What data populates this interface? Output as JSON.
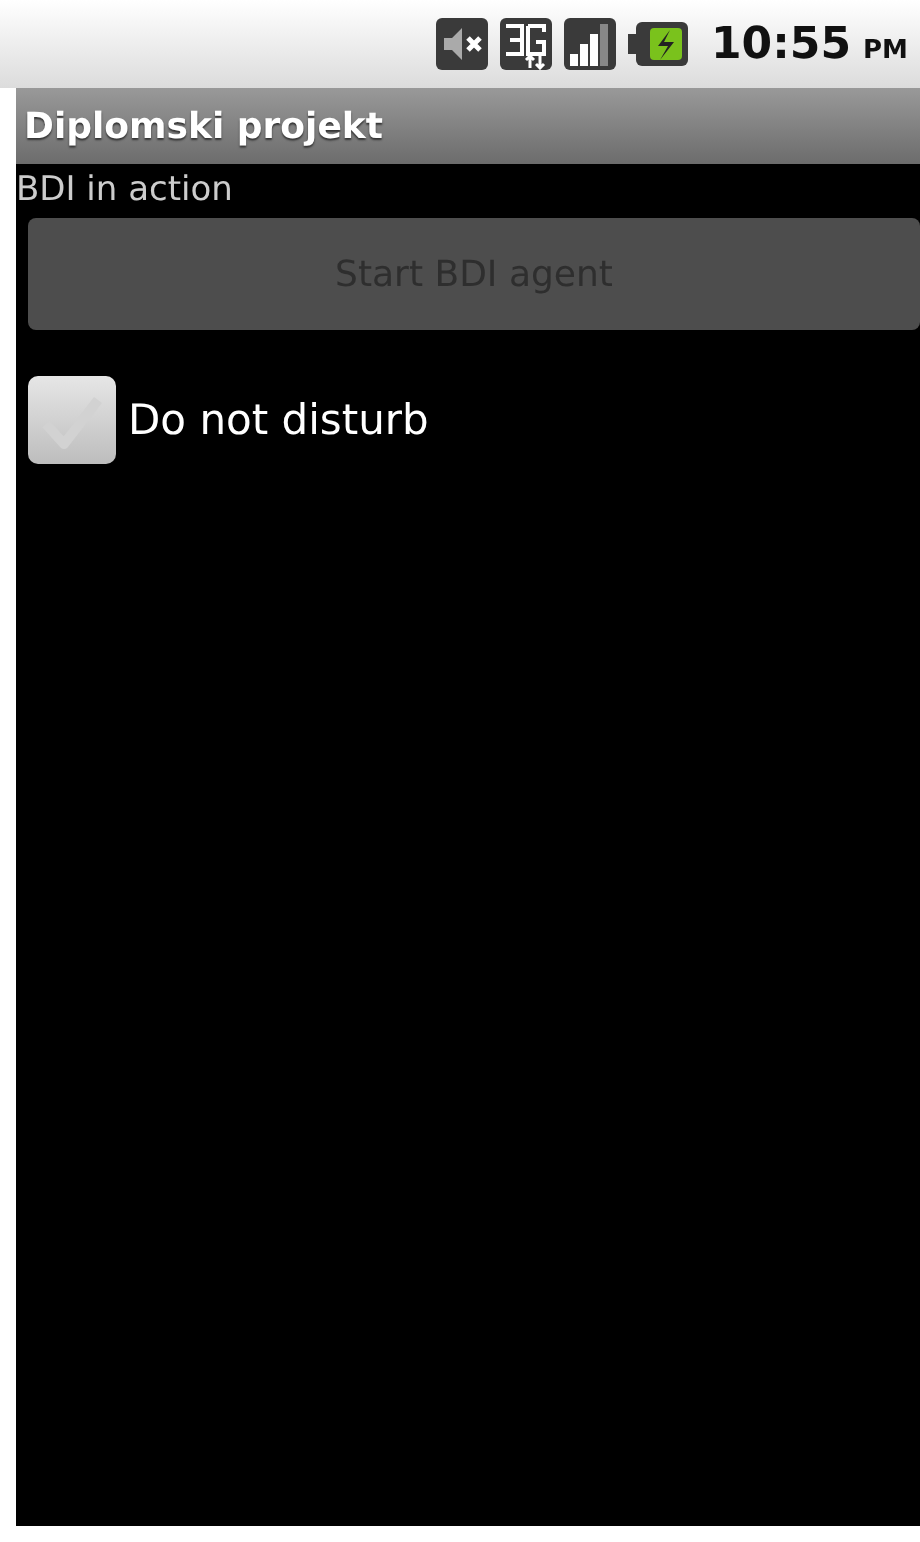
{
  "status_bar": {
    "time": "10:55",
    "ampm": "PM"
  },
  "window": {
    "title": "Diplomski projekt"
  },
  "heading": "BDI in action",
  "button": {
    "label": "Start BDI agent",
    "disabled": true
  },
  "checkbox": {
    "label": "Do not disturb",
    "checked": false
  }
}
